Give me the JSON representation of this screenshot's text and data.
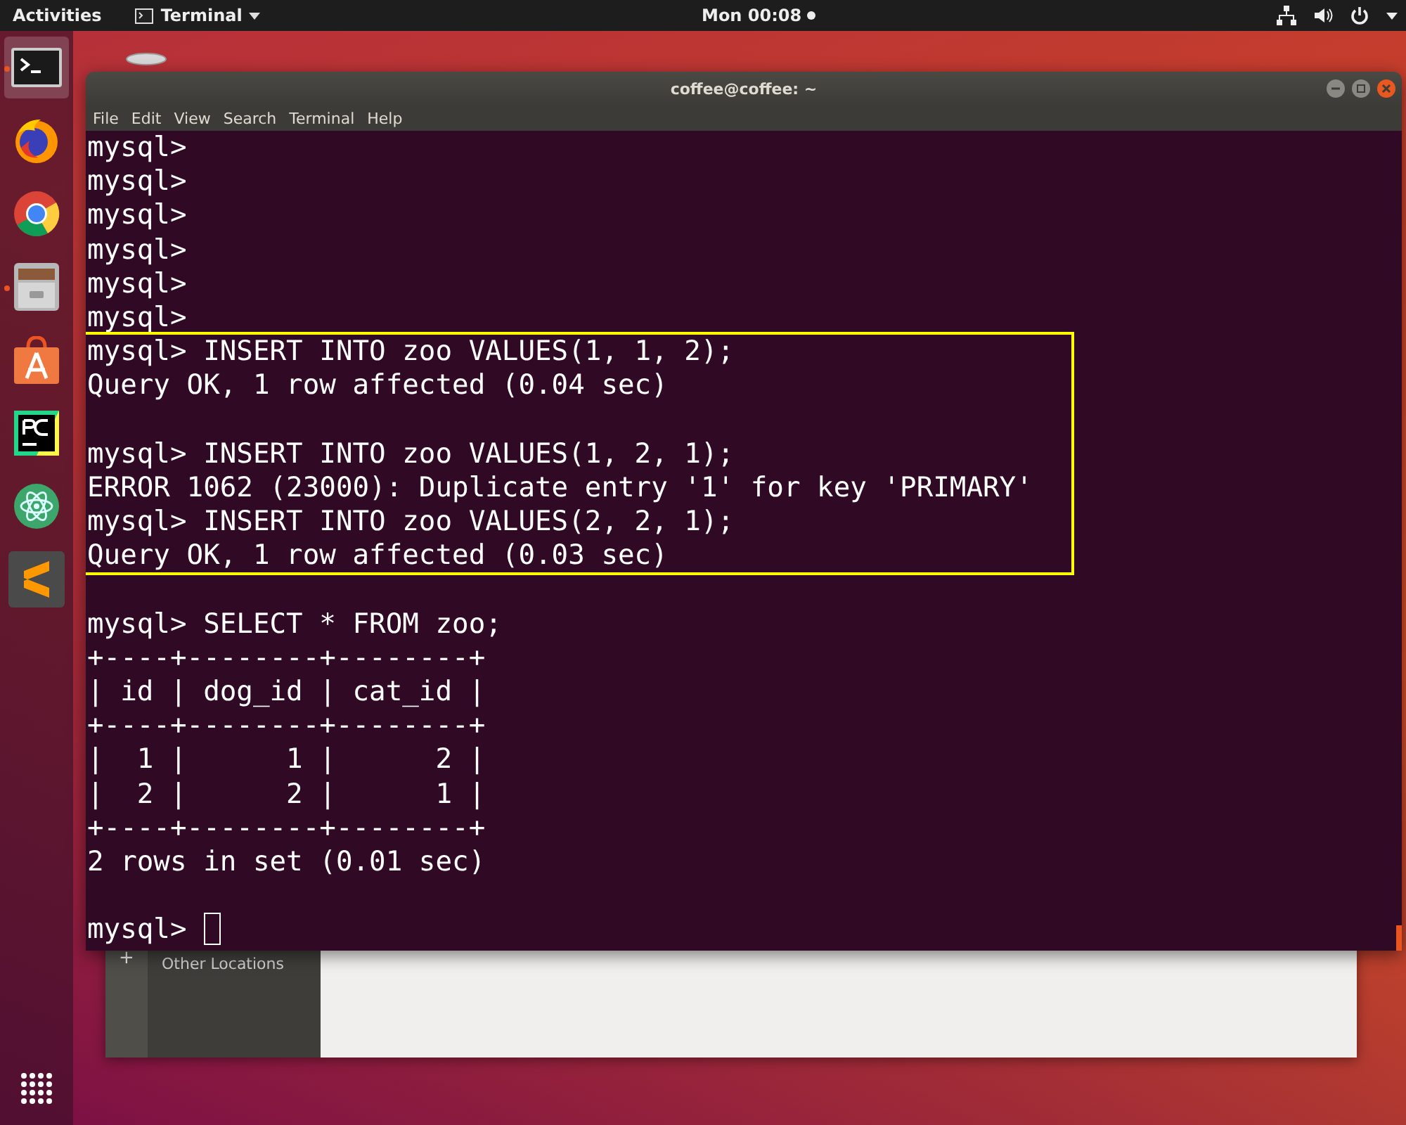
{
  "top_bar": {
    "activities": "Activities",
    "app_menu": "Terminal",
    "clock": "Mon 00:08",
    "notification": true
  },
  "dock": {
    "items": [
      {
        "kind": "terminal",
        "running": true,
        "selected": true
      },
      {
        "kind": "fox",
        "running": false,
        "selected": false
      },
      {
        "kind": "ring",
        "running": false,
        "selected": false
      },
      {
        "kind": "cabinet",
        "running": true,
        "selected": false
      },
      {
        "kind": "bag",
        "running": false,
        "selected": false
      },
      {
        "kind": "ide",
        "running": false,
        "selected": false
      },
      {
        "kind": "atom",
        "running": false,
        "selected": false
      },
      {
        "kind": "zigzag",
        "running": false,
        "selected": false
      }
    ]
  },
  "background_window": {
    "sidebar_items": [
      {
        "icon": "+",
        "label": "Other Locations"
      }
    ]
  },
  "terminal": {
    "title": "coffee@coffee: ~",
    "menu": [
      "File",
      "Edit",
      "View",
      "Search",
      "Terminal",
      "Help"
    ],
    "blocks": [
      {
        "highlighted": false,
        "lines": [
          {
            "kind": "text",
            "text": "mysql>"
          },
          {
            "kind": "text",
            "text": "mysql>"
          },
          {
            "kind": "text",
            "text": "mysql>"
          },
          {
            "kind": "text",
            "text": "mysql>"
          },
          {
            "kind": "text",
            "text": "mysql>"
          },
          {
            "kind": "text",
            "text": "mysql>"
          }
        ]
      },
      {
        "highlighted": true,
        "lines": [
          {
            "kind": "text",
            "text": "mysql> INSERT INTO zoo VALUES(1, 1, 2);"
          },
          {
            "kind": "text",
            "text": "Query OK, 1 row affected (0.04 sec)"
          },
          {
            "kind": "blank"
          },
          {
            "kind": "text",
            "text": "mysql> INSERT INTO zoo VALUES(1, 2, 1);"
          },
          {
            "kind": "text",
            "text": "ERROR 1062 (23000): Duplicate entry '1' for key 'PRIMARY'"
          },
          {
            "kind": "text",
            "text": "mysql> INSERT INTO zoo VALUES(2, 2, 1);"
          },
          {
            "kind": "text",
            "text": "Query OK, 1 row affected (0.03 sec)"
          }
        ]
      },
      {
        "highlighted": false,
        "lines": [
          {
            "kind": "blank"
          },
          {
            "kind": "text",
            "text": "mysql> SELECT * FROM zoo;"
          },
          {
            "kind": "text",
            "text": "+----+--------+--------+"
          },
          {
            "kind": "text",
            "text": "| id | dog_id | cat_id |"
          },
          {
            "kind": "text",
            "text": "+----+--------+--------+"
          },
          {
            "kind": "text",
            "text": "|  1 |      1 |      2 |"
          },
          {
            "kind": "text",
            "text": "|  2 |      2 |      1 |"
          },
          {
            "kind": "text",
            "text": "+----+--------+--------+"
          },
          {
            "kind": "text",
            "text": "2 rows in set (0.01 sec)"
          },
          {
            "kind": "blank"
          },
          {
            "kind": "prompt",
            "text": "mysql>"
          }
        ]
      }
    ]
  }
}
